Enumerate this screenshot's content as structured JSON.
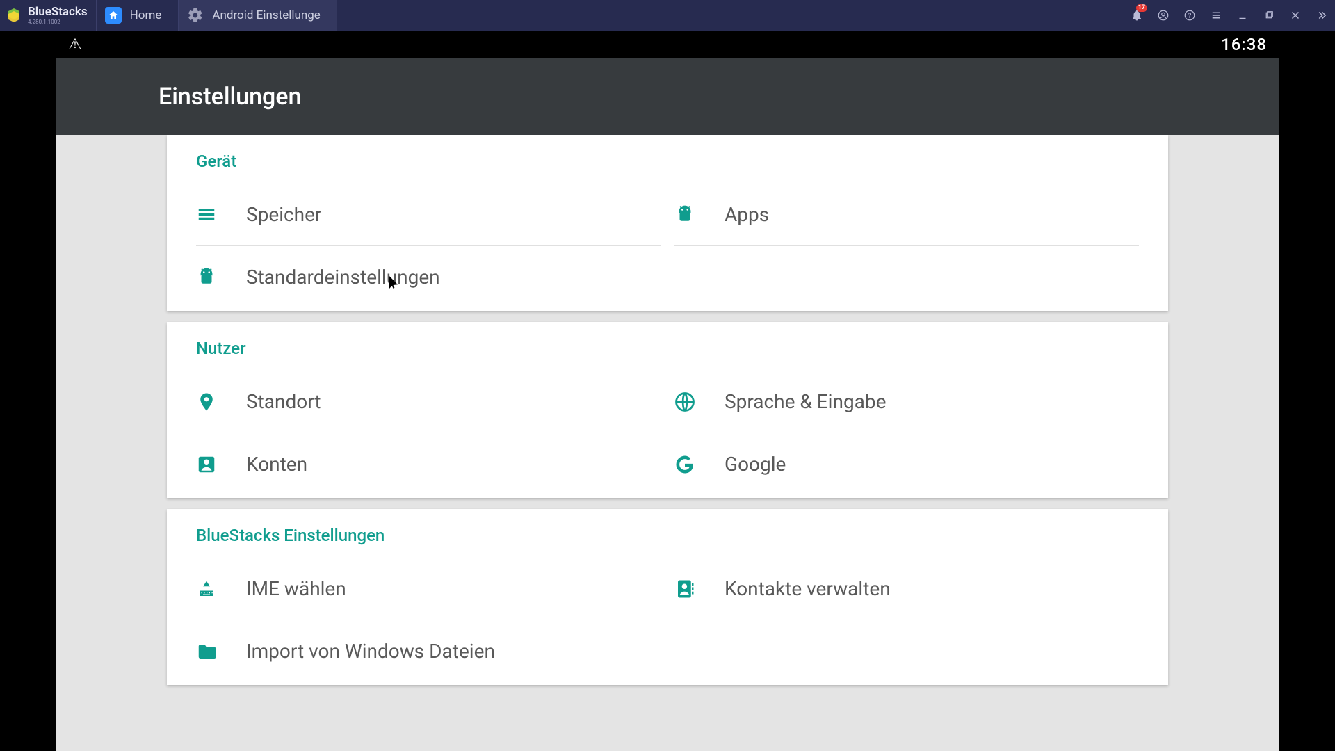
{
  "titlebar": {
    "app_name": "BlueStacks",
    "app_version": "4.280.1.1002",
    "tabs": [
      {
        "label": "Home"
      },
      {
        "label": "Android Einstellunge"
      }
    ],
    "notification_count": "17"
  },
  "status_bar": {
    "time": "16:38"
  },
  "app_bar": {
    "title": "Einstellungen"
  },
  "sections": {
    "device": {
      "title": "Gerät",
      "storage": "Speicher",
      "apps": "Apps",
      "defaults": "Standardeinstellungen"
    },
    "user": {
      "title": "Nutzer",
      "location": "Standort",
      "language": "Sprache & Eingabe",
      "accounts": "Konten",
      "google": "Google"
    },
    "bluestacks": {
      "title": "BlueStacks Einstellungen",
      "ime": "IME wählen",
      "contacts": "Kontakte verwalten",
      "import": "Import von Windows Dateien"
    }
  }
}
